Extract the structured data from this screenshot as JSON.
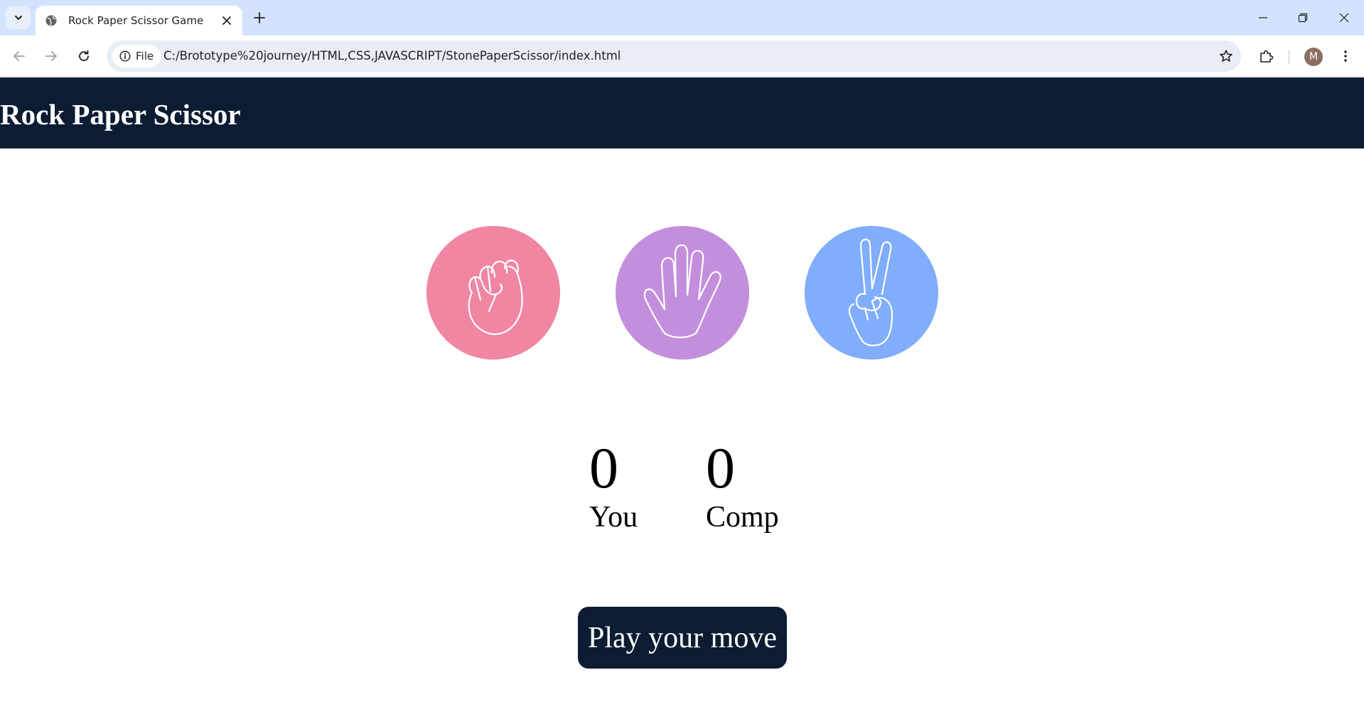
{
  "browser": {
    "tab_title": "Rock Paper Scissor Game",
    "site_chip_label": "File",
    "url": "C:/Brototype%20journey/HTML,CSS,JAVASCRIPT/StonePaperScissor/index.html",
    "profile_initial": "M"
  },
  "page": {
    "title": "Rock Paper Scissor",
    "choices": [
      {
        "id": "rock",
        "color": "#f186a2",
        "icon": "fist-icon"
      },
      {
        "id": "paper",
        "color": "#c38fdd",
        "icon": "open-hand-icon"
      },
      {
        "id": "scissor",
        "color": "#80adfc",
        "icon": "peace-hand-icon"
      }
    ],
    "scores": {
      "user_score": "0",
      "user_label": "You",
      "comp_score": "0",
      "comp_label": "Comp"
    },
    "message": "Play your move",
    "colors": {
      "header_bg": "#0b1c33",
      "message_bg": "#0b1c33"
    }
  }
}
